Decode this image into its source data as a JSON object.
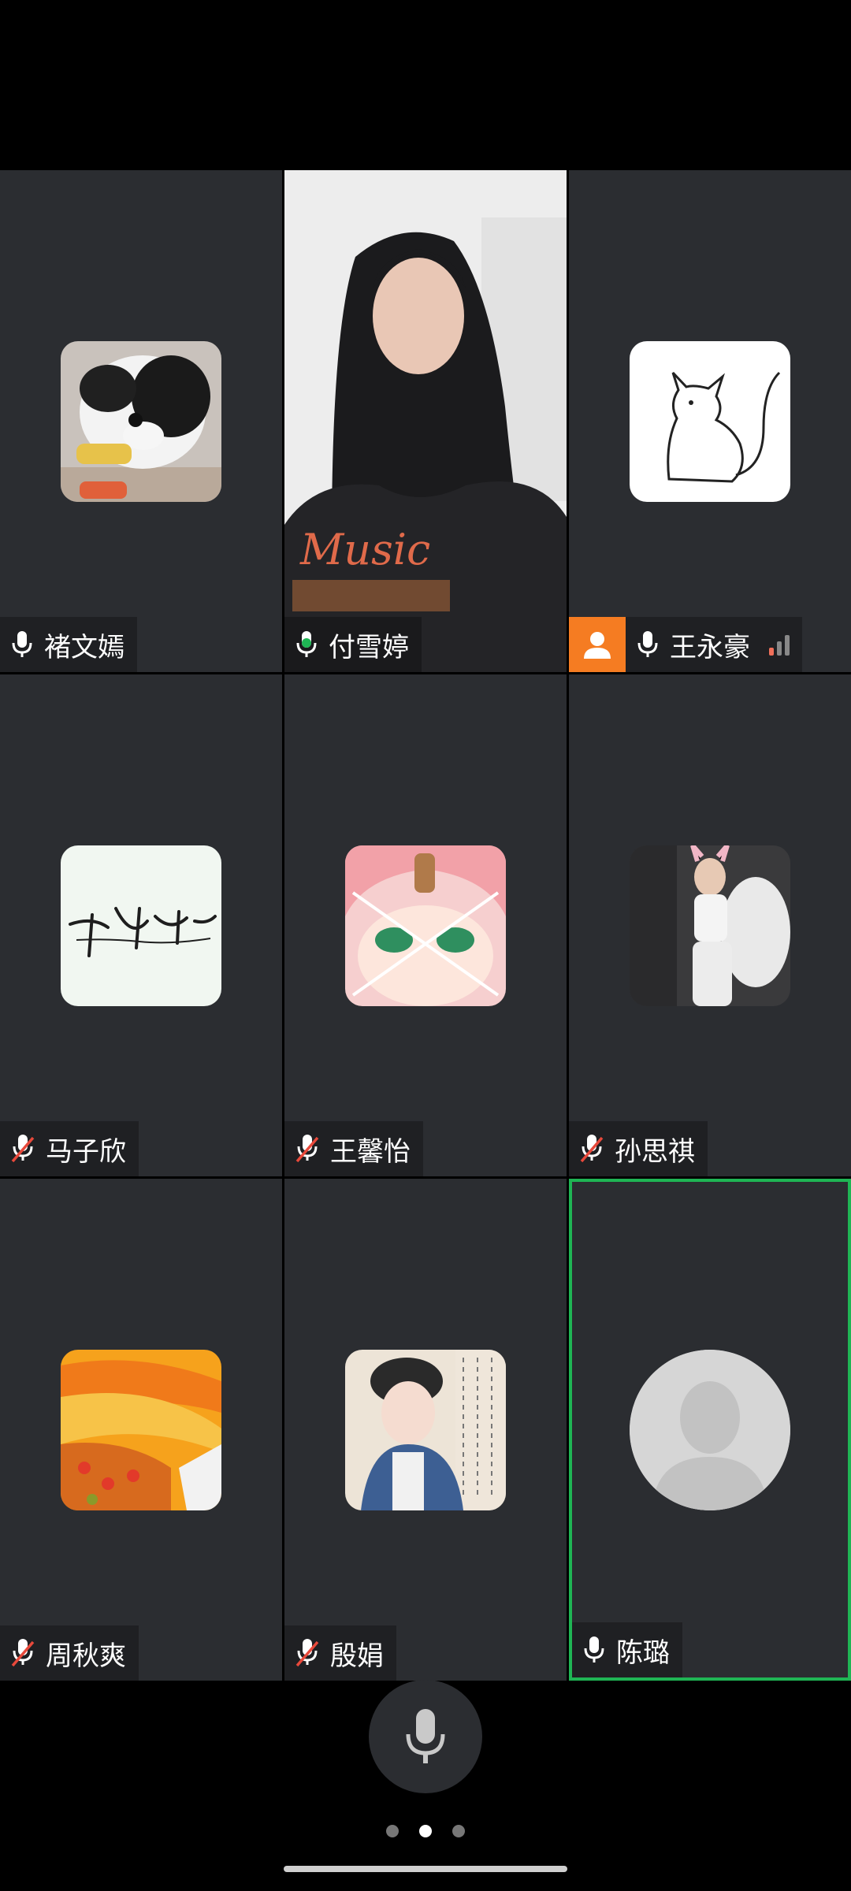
{
  "participants": [
    {
      "name": "褚文嫣",
      "mic": "on",
      "avatar": "puppy-photo"
    },
    {
      "name": "付雪婷",
      "mic": "speaking",
      "avatar": "video-feed"
    },
    {
      "name": "王永豪",
      "mic": "on",
      "avatar": "cat-drawing",
      "host": true
    },
    {
      "name": "马子欣",
      "mic": "muted",
      "avatar": "calligraphy"
    },
    {
      "name": "王馨怡",
      "mic": "muted",
      "avatar": "anime-girl"
    },
    {
      "name": "孙思祺",
      "mic": "muted",
      "avatar": "party-photo"
    },
    {
      "name": "周秋爽",
      "mic": "muted",
      "avatar": "orange-painting"
    },
    {
      "name": "殷娟",
      "mic": "muted",
      "avatar": "illustrated-woman"
    },
    {
      "name": "陈璐",
      "mic": "on",
      "avatar": "default-person",
      "active": true
    }
  ],
  "pager": {
    "pages": 3,
    "current": 2
  },
  "colors": {
    "active_border": "#1fb554",
    "host_badge": "#f57c22",
    "tile_bg": "#2b2d31"
  }
}
